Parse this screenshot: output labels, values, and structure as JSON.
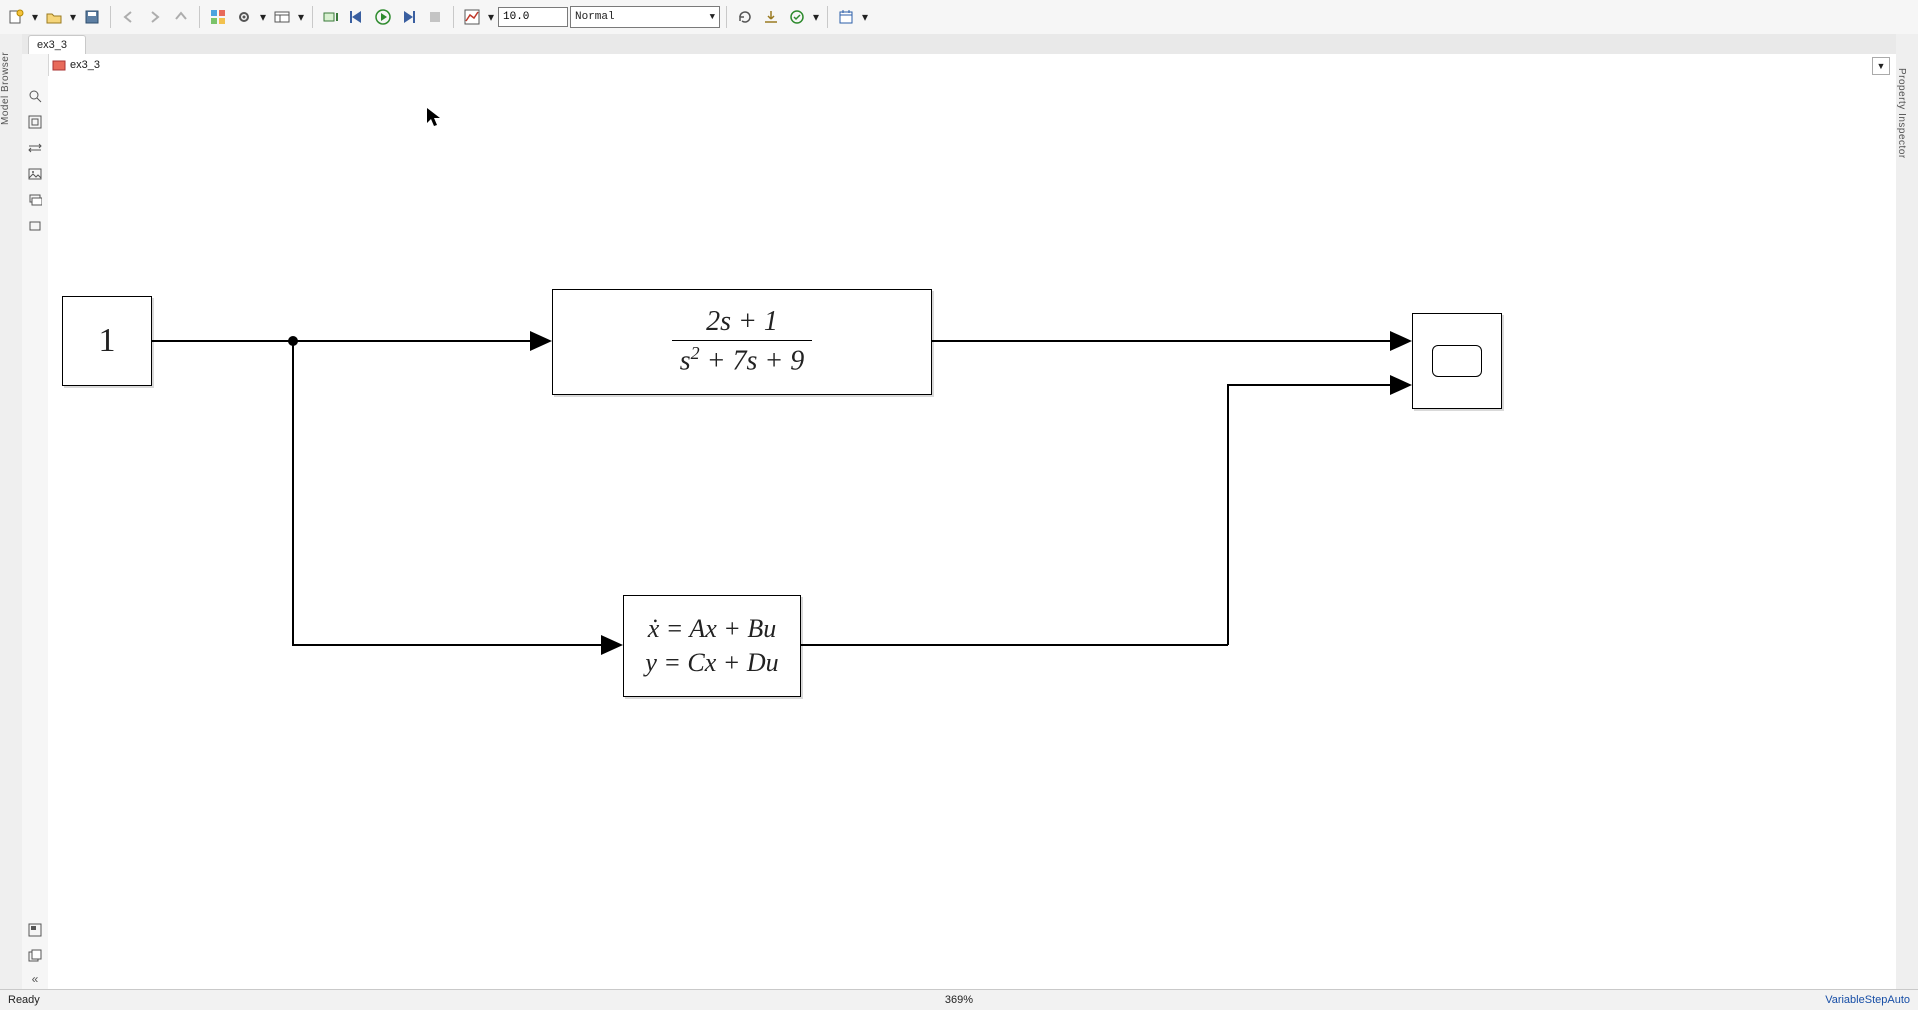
{
  "toolbar": {
    "stop_time": "10.0",
    "mode": "Normal"
  },
  "tabs": {
    "items": [
      {
        "label": "ex3_3"
      }
    ]
  },
  "breadcrumb": {
    "label": "ex3_3"
  },
  "palette": {
    "model_browser_label": "Model Browser",
    "property_inspector_label": "Property Inspector"
  },
  "diagram": {
    "constant": {
      "value": "1"
    },
    "tf": {
      "numerator": "2s + 1",
      "denominator_html": "s<sup style='font-style:italic;font-size:18px;'>2</sup> + 7s + 9"
    },
    "ss": {
      "line1": "ẋ = Ax + Bu",
      "line2": "y = Cx + Du"
    }
  },
  "status": {
    "left": "Ready",
    "zoom": "369%",
    "solver": "VariableStepAuto"
  },
  "chart_data": {
    "type": "block-diagram",
    "tool": "Simulink",
    "blocks": [
      {
        "id": "const",
        "type": "Constant",
        "value": 1
      },
      {
        "id": "tf",
        "type": "TransferFcn",
        "numerator": [
          2,
          1
        ],
        "denominator": [
          1,
          7,
          9
        ]
      },
      {
        "id": "ss",
        "type": "StateSpace",
        "equations": [
          "xdot = A x + B u",
          "y = C x + D u"
        ]
      },
      {
        "id": "scope",
        "type": "Scope",
        "inputs": 2
      }
    ],
    "connections": [
      {
        "from": "const",
        "to": "tf",
        "branch_point": true
      },
      {
        "from": "const",
        "to": "ss",
        "via_branch": true
      },
      {
        "from": "tf",
        "to": "scope",
        "port": 1
      },
      {
        "from": "ss",
        "to": "scope",
        "port": 2
      }
    ],
    "simulation": {
      "stop_time": 10.0,
      "mode": "Normal",
      "solver": "VariableStepAuto"
    }
  }
}
